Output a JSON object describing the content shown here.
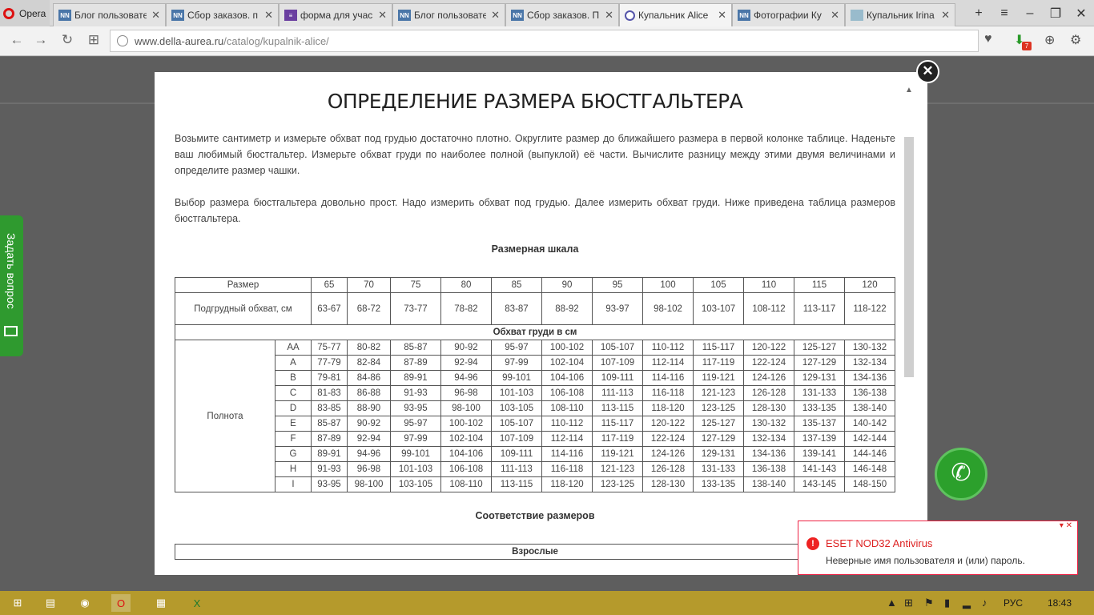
{
  "browser": {
    "menu_label": "Opera",
    "tabs": [
      {
        "label": "Блог пользовате",
        "icon": "NN"
      },
      {
        "label": "Сбор заказов. п",
        "icon": "NN"
      },
      {
        "label": "форма для учас",
        "icon": "form"
      },
      {
        "label": "Блог пользовате",
        "icon": "NN"
      },
      {
        "label": "Сбор заказов. П",
        "icon": "NN"
      },
      {
        "label": "Купальник Alice",
        "icon": "ring"
      },
      {
        "label": "Фотографии Ку",
        "icon": "NN"
      },
      {
        "label": "Купальник Irina",
        "icon": "img"
      }
    ],
    "url_domain": "www.della-aurea.ru",
    "url_path": "/catalog/kupalnik-alice/"
  },
  "side_tab": {
    "label": "Задать вопрос"
  },
  "modal": {
    "title": "ОПРЕДЕЛЕНИЕ РАЗМЕРА БЮСТГАЛЬТЕРА",
    "para1": "Возьмите сантиметр и измерьте обхват под грудью достаточно плотно. Округлите размер до ближайшего размера в первой колонке таблице. Наденьте ваш любимый бюстгальтер. Измерьте обхват груди по наиболее полной (выпуклой) её части. Вычислите разницу между этими двумя величинами и определите размер чашки.",
    "para2": "Выбор размера бюстгальтера довольно прост. Надо измерить обхват под грудью. Далее измерить обхват груди. Ниже приведена таблица размеров бюстгальтера.",
    "scale_title": "Размерная шкала",
    "table": {
      "size_label": "Размер",
      "sizes": [
        "65",
        "70",
        "75",
        "80",
        "85",
        "90",
        "95",
        "100",
        "105",
        "110",
        "115",
        "120"
      ],
      "under_label": "Подгрудный обхват, см",
      "under": [
        "63-67",
        "68-72",
        "73-77",
        "78-82",
        "83-87",
        "88-92",
        "93-97",
        "98-102",
        "103-107",
        "108-112",
        "113-117",
        "118-122"
      ],
      "chest_header": "Обхват груди в см",
      "fullness_label": "Полнота",
      "rows": [
        {
          "cup": "AA",
          "values": [
            "75-77",
            "80-82",
            "85-87",
            "90-92",
            "95-97",
            "100-102",
            "105-107",
            "110-112",
            "115-117",
            "120-122",
            "125-127",
            "130-132"
          ]
        },
        {
          "cup": "A",
          "values": [
            "77-79",
            "82-84",
            "87-89",
            "92-94",
            "97-99",
            "102-104",
            "107-109",
            "112-114",
            "117-119",
            "122-124",
            "127-129",
            "132-134"
          ]
        },
        {
          "cup": "B",
          "values": [
            "79-81",
            "84-86",
            "89-91",
            "94-96",
            "99-101",
            "104-106",
            "109-111",
            "114-116",
            "119-121",
            "124-126",
            "129-131",
            "134-136"
          ]
        },
        {
          "cup": "C",
          "values": [
            "81-83",
            "86-88",
            "91-93",
            "96-98",
            "101-103",
            "106-108",
            "111-113",
            "116-118",
            "121-123",
            "126-128",
            "131-133",
            "136-138"
          ]
        },
        {
          "cup": "D",
          "values": [
            "83-85",
            "88-90",
            "93-95",
            "98-100",
            "103-105",
            "108-110",
            "113-115",
            "118-120",
            "123-125",
            "128-130",
            "133-135",
            "138-140"
          ]
        },
        {
          "cup": "E",
          "values": [
            "85-87",
            "90-92",
            "95-97",
            "100-102",
            "105-107",
            "110-112",
            "115-117",
            "120-122",
            "125-127",
            "130-132",
            "135-137",
            "140-142"
          ]
        },
        {
          "cup": "F",
          "values": [
            "87-89",
            "92-94",
            "97-99",
            "102-104",
            "107-109",
            "112-114",
            "117-119",
            "122-124",
            "127-129",
            "132-134",
            "137-139",
            "142-144"
          ]
        },
        {
          "cup": "G",
          "values": [
            "89-91",
            "94-96",
            "99-101",
            "104-106",
            "109-111",
            "114-116",
            "119-121",
            "124-126",
            "129-131",
            "134-136",
            "139-141",
            "144-146"
          ]
        },
        {
          "cup": "H",
          "values": [
            "91-93",
            "96-98",
            "101-103",
            "106-108",
            "111-113",
            "116-118",
            "121-123",
            "126-128",
            "131-133",
            "136-138",
            "141-143",
            "146-148"
          ]
        },
        {
          "cup": "I",
          "values": [
            "93-95",
            "98-100",
            "103-105",
            "108-110",
            "113-115",
            "118-120",
            "123-125",
            "128-130",
            "133-135",
            "138-140",
            "143-145",
            "148-150"
          ]
        }
      ]
    },
    "correspondence_title": "Соответствие размеров",
    "adults_label": "Взрослые"
  },
  "notification": {
    "title": "ESET NOD32 Antivirus",
    "message": "Неверные имя пользователя и (или) пароль."
  },
  "taskbar": {
    "lang": "РУС",
    "time": "18:43"
  }
}
